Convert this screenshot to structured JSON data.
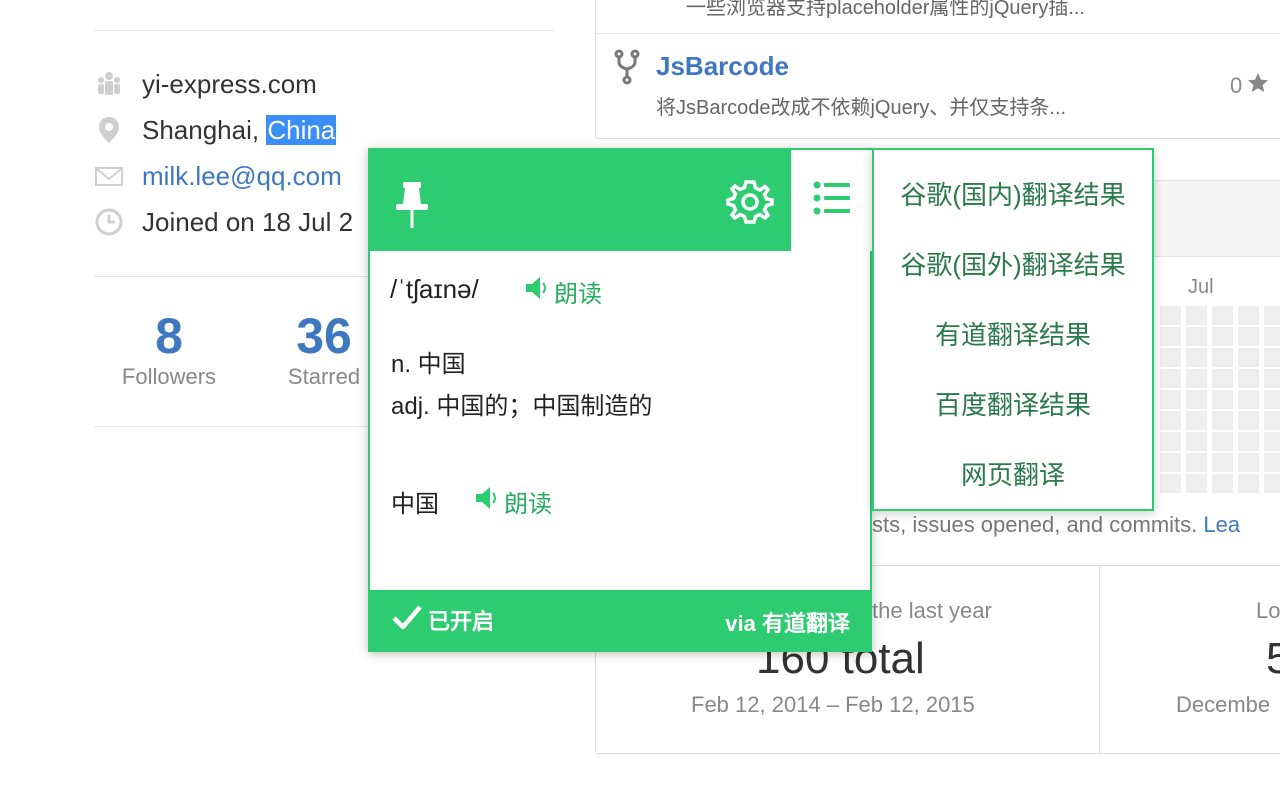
{
  "profile": {
    "website": "yi-express.com",
    "location_prefix": "Shanghai, ",
    "location_selected": "China",
    "email": "milk.lee@qq.com",
    "joined": "Joined on 18 Jul 2",
    "stats": [
      {
        "value": "8",
        "label": "Followers"
      },
      {
        "value": "36",
        "label": "Starred"
      }
    ]
  },
  "repos": {
    "cut_off_desc": "一些浏览器支持placeholder属性的jQuery插...",
    "item": {
      "name": "JsBarcode",
      "description": "将JsBarcode改成不依赖jQuery、并仅支持条...",
      "stars": "0"
    }
  },
  "contributions": {
    "month": "Jul",
    "note": "sts, issues opened, and commits. ",
    "note_link": "Lea",
    "year_label": "the last year",
    "year_total": "160 total",
    "year_range": "Feb 12, 2014 – Feb 12, 2015",
    "longest_label": "Lo",
    "longest_value": "5",
    "longest_range": "Decembe"
  },
  "translator": {
    "phonetic": "/ˈtʃaɪnə/",
    "speak_label": "朗读",
    "definitions": [
      "n. 中国",
      "adj. 中国的；中国制造的"
    ],
    "translation": "中国",
    "footer_status": "已开启",
    "footer_via": "via 有道翻译",
    "menu": [
      "谷歌(国内)翻译结果",
      "谷歌(国外)翻译结果",
      "有道翻译结果",
      "百度翻译结果",
      "网页翻译"
    ],
    "accent_color": "#2ecc71"
  }
}
